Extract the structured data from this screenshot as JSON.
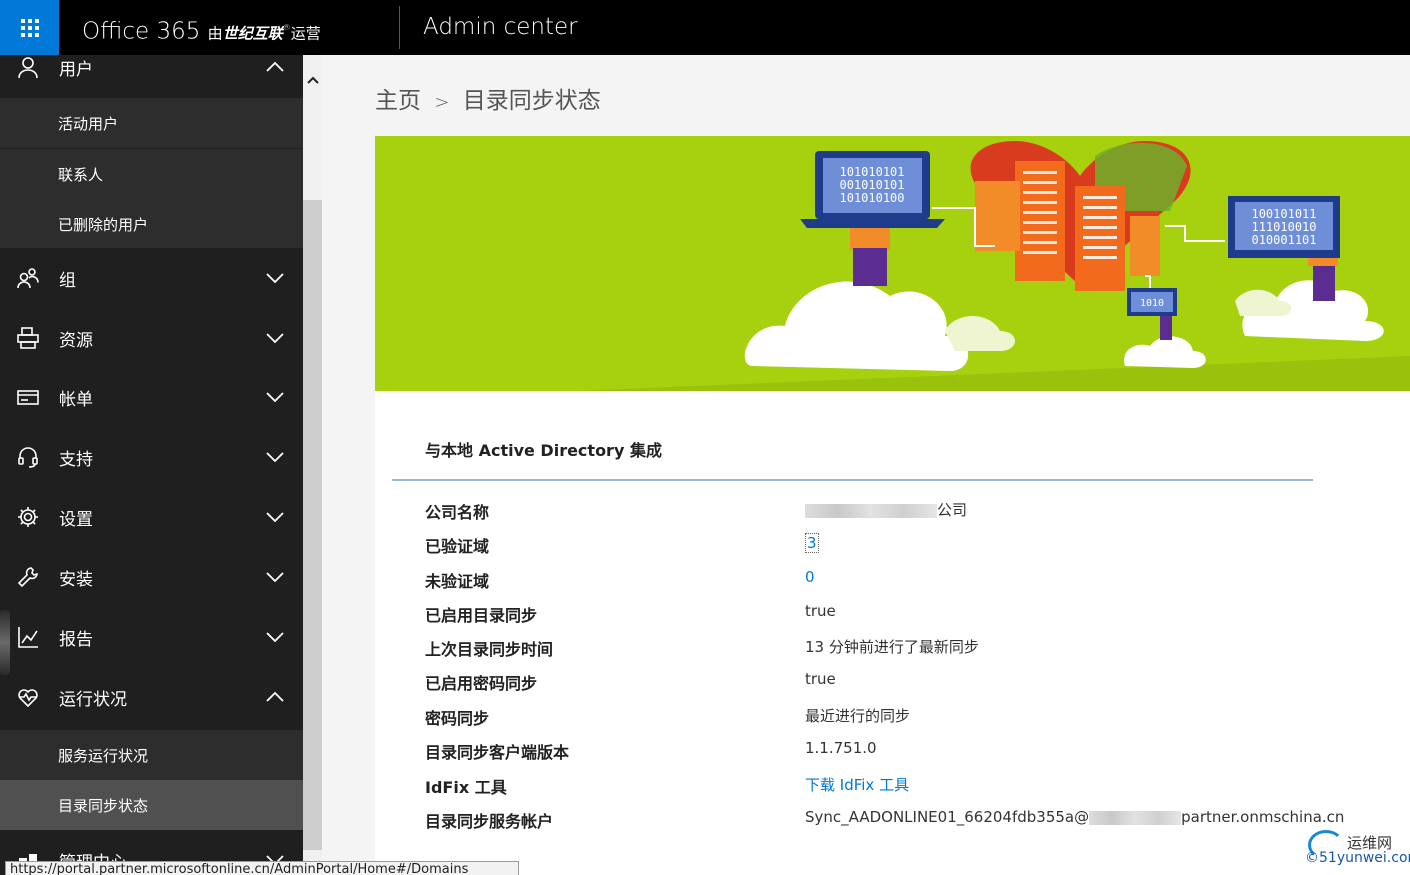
{
  "topbar": {
    "brand_prefix": "Office 365 ",
    "brand_by": "由",
    "brand_operator": "世纪互联",
    "brand_suffix": "运营",
    "app_title": "Admin center"
  },
  "sidebar": {
    "items": [
      {
        "label": "用户",
        "icon": "user-icon",
        "expanded": true
      },
      {
        "label": "活动用户"
      },
      {
        "label": "联系人"
      },
      {
        "label": "已删除的用户"
      },
      {
        "label": "组",
        "icon": "group-icon"
      },
      {
        "label": "资源",
        "icon": "resources-icon"
      },
      {
        "label": "帐单",
        "icon": "billing-icon"
      },
      {
        "label": "支持",
        "icon": "headset-icon"
      },
      {
        "label": "设置",
        "icon": "gear-icon"
      },
      {
        "label": "安装",
        "icon": "wrench-icon"
      },
      {
        "label": "报告",
        "icon": "chart-icon"
      },
      {
        "label": "运行状况",
        "icon": "heart-pulse-icon",
        "expanded": true
      },
      {
        "label": "服务运行状况"
      },
      {
        "label": "目录同步状态",
        "active": true
      },
      {
        "label": "管理中心",
        "icon": "admin-icon"
      }
    ]
  },
  "breadcrumb": {
    "home": "主页",
    "sep": ">",
    "current": "目录同步状态"
  },
  "hero": {
    "screen1": [
      "101010101",
      "001010101",
      "101010100"
    ],
    "screen2": [
      "100101011",
      "111010010",
      "010001101"
    ],
    "screen3": "1010",
    "colors": {
      "background": "#a7d10f",
      "heart_red": "#d93b1f",
      "building_orange": "#f26a1b",
      "screen_blue": "#1f3b8c",
      "purple": "#5c2d91"
    }
  },
  "card": {
    "title": "与本地 Active Directory 集成",
    "rows": [
      {
        "key": "公司名称",
        "value": "公司"
      },
      {
        "key": "已验证域",
        "value": "3"
      },
      {
        "key": "未验证域",
        "value": "0"
      },
      {
        "key": "已启用目录同步",
        "value": "true"
      },
      {
        "key": "上次目录同步时间",
        "value": "13 分钟前进行了最新同步"
      },
      {
        "key": "已启用密码同步",
        "value": "true"
      },
      {
        "key": "密码同步",
        "value": "最近进行的同步"
      },
      {
        "key": "目录同步客户端版本",
        "value": "1.1.751.0"
      },
      {
        "key": "IdFix 工具",
        "value": "下载 IdFix 工具"
      },
      {
        "key": "目录同步服务帐户",
        "value_prefix": "Sync_AADONLINE01_66204fdb355a@",
        "value_suffix": "partner.onmschina.cn"
      }
    ]
  },
  "statusbar": {
    "url": "https://portal.partner.microsoftonline.cn/AdminPortal/Home#/Domains"
  },
  "watermark": {
    "line1": "运维网",
    "line2": "©51yunwei.com"
  }
}
